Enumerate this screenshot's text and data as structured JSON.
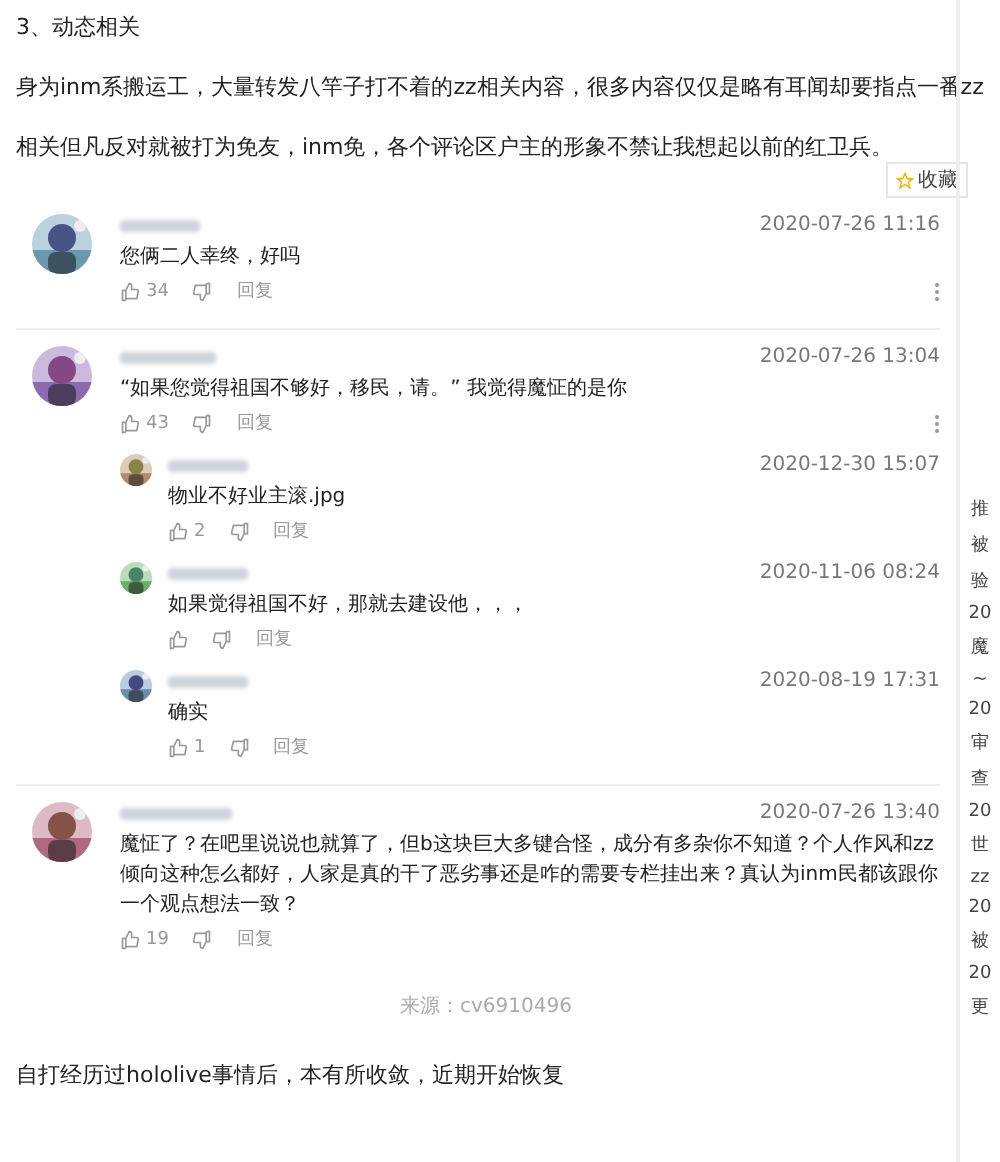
{
  "heading": "3、动态相关",
  "intro": "身为inm系搬运工，大量转发八竿子打不着的zz相关内容，很多内容仅仅是略有耳闻却要指点一番zz相关但凡反对就被打为免友，inm免，各个评论区户主的形象不禁让我想起以前的红卫兵。",
  "bookmark": {
    "label": "收藏"
  },
  "comments": [
    {
      "date": "2020-07-26 11:16",
      "text": "您俩二人幸终，好吗",
      "likes": "34",
      "reply_label": "回复",
      "more": true
    },
    {
      "date": "2020-07-26 13:04",
      "text": "“如果您觉得祖国不够好，移民，请。” 我觉得魔怔的是你",
      "likes": "43",
      "reply_label": "回复",
      "more": true,
      "replies": [
        {
          "date": "2020-12-30 15:07",
          "text": "物业不好业主滚.jpg",
          "likes": "2",
          "reply_label": "回复"
        },
        {
          "date": "2020-11-06 08:24",
          "text": "如果觉得祖国不好，那就去建设他，，，",
          "reply_label": "回复"
        },
        {
          "date": "2020-08-19 17:31",
          "text": "确实",
          "likes": "1",
          "reply_label": "回复"
        }
      ]
    },
    {
      "date": "2020-07-26 13:40",
      "text": "魔怔了？在吧里说说也就算了，但b这块巨大多键合怪，成分有多杂你不知道？个人作风和zz倾向这种怎么都好，人家是真的干了恶劣事还是咋的需要专栏挂出来？真认为inm民都该跟你一个观点想法一致？",
      "likes": "19",
      "reply_label": "回复",
      "more": false
    }
  ],
  "source": "来源：cv6910496",
  "footer": "自打经历过hololive事情后，本有所收敛，近期开始恢复",
  "sidebar": {
    "items": [
      "推",
      "被",
      "验",
      "20",
      "魔",
      "~",
      "20",
      "审",
      "查",
      "20",
      "世",
      "zz",
      "20",
      "被",
      "20",
      "更"
    ]
  }
}
